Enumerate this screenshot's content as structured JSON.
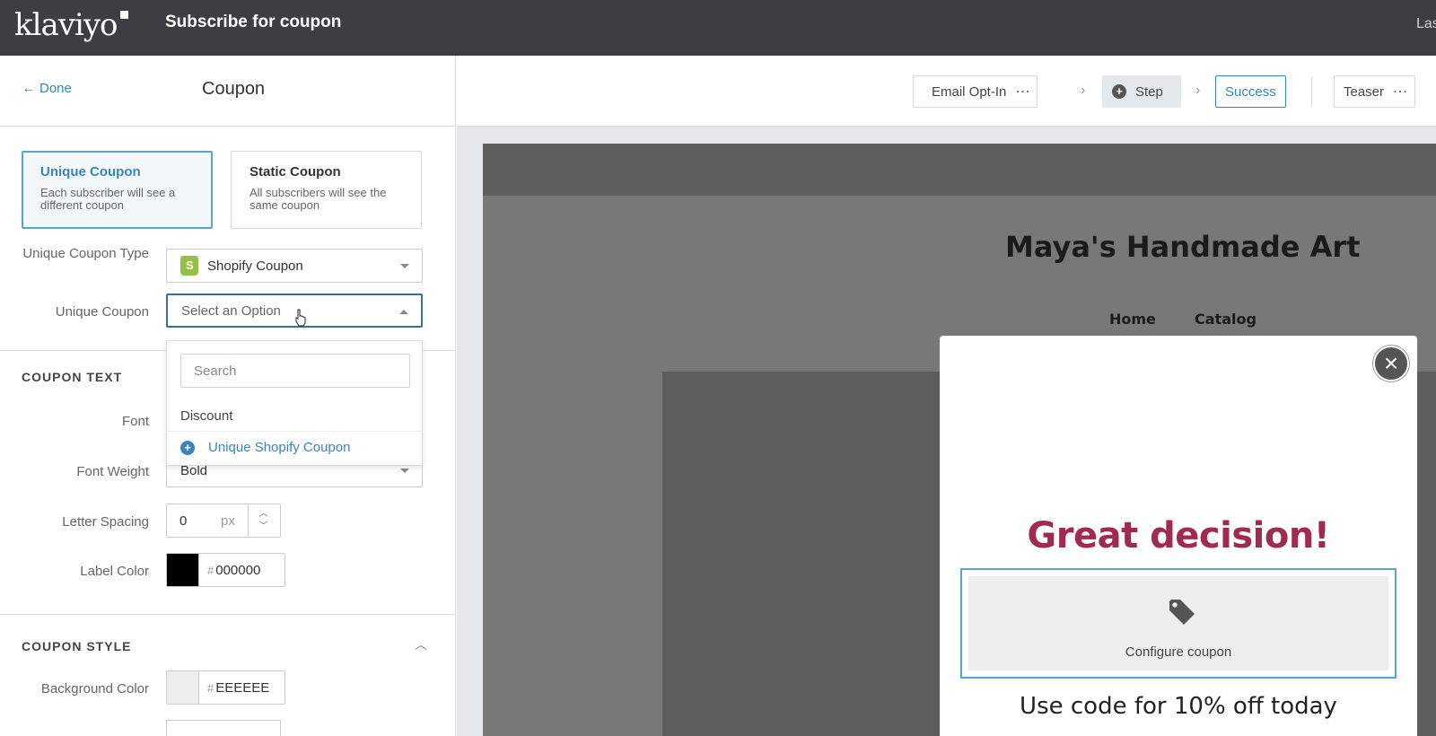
{
  "topbar": {
    "logo_text": "klaviyo",
    "title": "Subscribe for coupon",
    "right_text": "Las"
  },
  "left_panel": {
    "back_label": "Done",
    "title": "Coupon",
    "coupon_types": [
      {
        "title": "Unique Coupon",
        "description": "Each subscriber will see a different coupon",
        "selected": true
      },
      {
        "title": "Static Coupon",
        "description": "All subscribers will see the same coupon",
        "selected": false
      }
    ],
    "unique_coupon_type": {
      "label": "Unique Coupon Type",
      "value": "Shopify Coupon"
    },
    "unique_coupon": {
      "label": "Unique Coupon",
      "placeholder": "Select an Option"
    },
    "dropdown": {
      "search_placeholder": "Search",
      "group_label": "Discount",
      "item_label": "Unique Shopify Coupon"
    },
    "coupon_text": {
      "section_title": "COUPON TEXT",
      "font_label": "Font",
      "font_weight_label": "Font Weight",
      "font_weight_value": "Bold",
      "letter_spacing_label": "Letter Spacing",
      "letter_spacing_value": "0",
      "letter_spacing_unit": "px",
      "label_color_label": "Label Color",
      "label_color_hex": "000000",
      "label_color_swatch": "#000000"
    },
    "coupon_style": {
      "section_title": "COUPON STYLE",
      "bg_color_label": "Background Color",
      "bg_color_hex": "EEEEEE",
      "bg_color_swatch": "#eeeeee"
    },
    "hash_symbol": "#"
  },
  "steps": {
    "email_optin": "Email Opt-In",
    "add_step": "Step",
    "success": "Success",
    "teaser": "Teaser"
  },
  "preview": {
    "site_title": "Maya's Handmade Art",
    "nav": [
      "Home",
      "Catalog"
    ],
    "popup": {
      "headline": "Great decision!",
      "coupon_placeholder": "Configure coupon",
      "footer_text": "Use code for 10% off today"
    }
  },
  "colors": {
    "accent": "#3a84b8",
    "headline": "#a02a50",
    "topbar": "#3b3f44"
  }
}
